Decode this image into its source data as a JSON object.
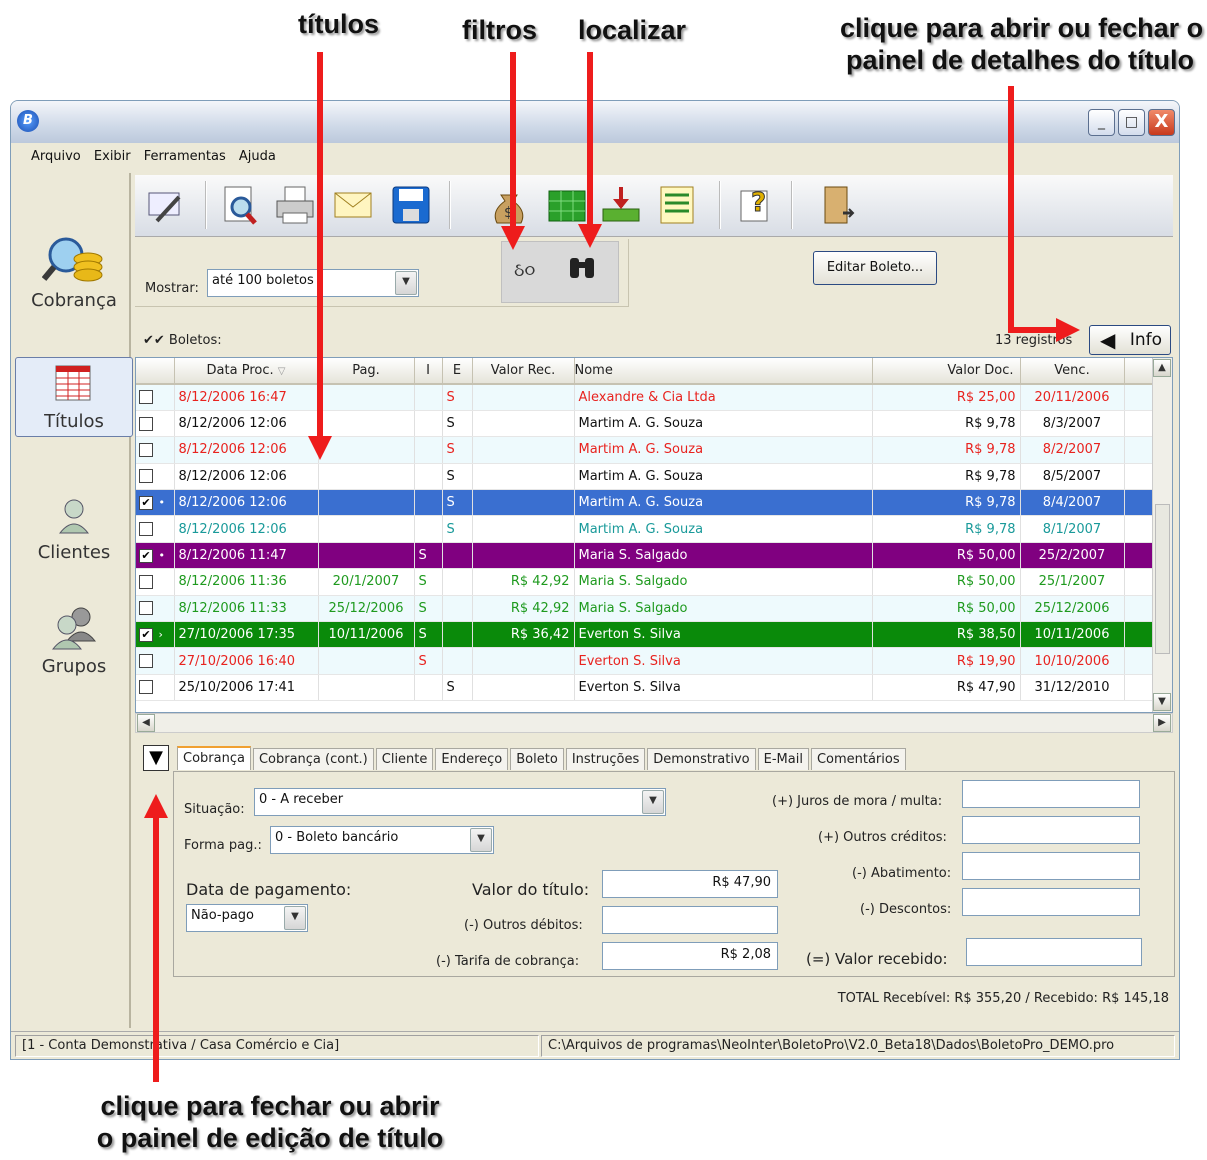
{
  "annotations": {
    "titulos": "títulos",
    "filtros": "filtros",
    "localizar": "localizar",
    "info_line1": "clique para abrir ou fechar o",
    "info_line2": "painel de detalhes do título",
    "edit_line1": "clique para fechar ou abrir",
    "edit_line2": "o painel de edição de título"
  },
  "window": {
    "minimize": "_",
    "maximize": "□",
    "close": "X",
    "logo": "B"
  },
  "menu": [
    "Arquivo",
    "Exibir",
    "Ferramentas",
    "Ajuda"
  ],
  "nav": {
    "cobranca": "Cobrança",
    "titulos": "Títulos",
    "clientes": "Clientes",
    "grupos": "Grupos"
  },
  "toolbar": [
    "edit-icon",
    "preview-icon",
    "print-icon",
    "mail-icon",
    "save-icon",
    "money-bag-icon",
    "spreadsheet-icon",
    "import-icon",
    "list-icon",
    "help-icon",
    "exit-icon"
  ],
  "filter": {
    "mostrar_label": "Mostrar:",
    "mostrar_value": "até 100 boletos",
    "filtros_icon": "glasses-icon",
    "localizar_icon": "binoculars-icon",
    "edit_button": "Editar Boleto...",
    "boletos_label": "✔✔ Boletos:",
    "registros": "13 registros",
    "info_button": "Info"
  },
  "grid": {
    "columns": [
      "",
      "Data Proc.",
      "Pag.",
      "I",
      "E",
      "Valor Rec.",
      "Nome",
      "Valor Doc.",
      "Venc."
    ],
    "rows": [
      {
        "sel": "",
        "data": "8/12/2006 16:47",
        "pag": "",
        "i": "",
        "e": "S",
        "valor_rec": "",
        "nome": "Alexandre & Cia Ltda",
        "valor_doc": "R$ 25,00",
        "venc": "20/11/2006",
        "color": "#e8231f",
        "bg": "#eefafd"
      },
      {
        "sel": "",
        "data": "8/12/2006 12:06",
        "pag": "",
        "i": "",
        "e": "S",
        "valor_rec": "",
        "nome": "Martim A. G. Souza",
        "valor_doc": "R$ 9,78",
        "venc": "8/3/2007",
        "color": "#111111",
        "bg": "#ffffff"
      },
      {
        "sel": "",
        "data": "8/12/2006 12:06",
        "pag": "",
        "i": "",
        "e": "S",
        "valor_rec": "",
        "nome": "Martim A. G. Souza",
        "valor_doc": "R$ 9,78",
        "venc": "8/2/2007",
        "color": "#e8231f",
        "bg": "#eefafd"
      },
      {
        "sel": "",
        "data": "8/12/2006 12:06",
        "pag": "",
        "i": "",
        "e": "S",
        "valor_rec": "",
        "nome": "Martim A. G. Souza",
        "valor_doc": "R$ 9,78",
        "venc": "8/5/2007",
        "color": "#111111",
        "bg": "#ffffff"
      },
      {
        "sel": "✔ •",
        "data": "8/12/2006 12:06",
        "pag": "",
        "i": "",
        "e": "S",
        "valor_rec": "",
        "nome": "Martim A. G. Souza",
        "valor_doc": "R$ 9,78",
        "venc": "8/4/2007",
        "color": "#ffffff",
        "bg": "#3a6fd0"
      },
      {
        "sel": "",
        "data": "8/12/2006 12:06",
        "pag": "",
        "i": "",
        "e": "S",
        "valor_rec": "",
        "nome": "Martim A. G. Souza",
        "valor_doc": "R$ 9,78",
        "venc": "8/1/2007",
        "color": "#1a9a9a",
        "bg": "#ffffff"
      },
      {
        "sel": "✔ •",
        "data": "8/12/2006 11:47",
        "pag": "",
        "i": "S",
        "e": "",
        "valor_rec": "",
        "nome": "Maria S. Salgado",
        "valor_doc": "R$ 50,00",
        "venc": "25/2/2007",
        "color": "#ffffff",
        "bg": "#800080"
      },
      {
        "sel": "",
        "data": "8/12/2006 11:36",
        "pag": "20/1/2007",
        "i": "S",
        "e": "",
        "valor_rec": "R$ 42,92",
        "nome": "Maria S. Salgado",
        "valor_doc": "R$ 50,00",
        "venc": "25/1/2007",
        "color": "#1f9a1f",
        "bg": "#ffffff"
      },
      {
        "sel": "",
        "data": "8/12/2006 11:33",
        "pag": "25/12/2006",
        "i": "S",
        "e": "",
        "valor_rec": "R$ 42,92",
        "nome": "Maria S. Salgado",
        "valor_doc": "R$ 50,00",
        "venc": "25/12/2006",
        "color": "#1f9a1f",
        "bg": "#eefafd"
      },
      {
        "sel": "✔ ›",
        "data": "27/10/2006 17:35",
        "pag": "10/11/2006",
        "i": "S",
        "e": "",
        "valor_rec": "R$ 36,42",
        "nome": "Everton S. Silva",
        "valor_doc": "R$ 38,50",
        "venc": "10/11/2006",
        "color": "#ffffff",
        "bg": "#0a8a0a"
      },
      {
        "sel": "",
        "data": "27/10/2006 16:40",
        "pag": "",
        "i": "S",
        "e": "",
        "valor_rec": "",
        "nome": "Everton S. Silva",
        "valor_doc": "R$ 19,90",
        "venc": "10/10/2006",
        "color": "#e8231f",
        "bg": "#eefafd"
      },
      {
        "sel": "",
        "data": "25/10/2006 17:41",
        "pag": "",
        "i": "",
        "e": "S",
        "valor_rec": "",
        "nome": "Everton S. Silva",
        "valor_doc": "R$ 47,90",
        "venc": "31/12/2010",
        "color": "#111111",
        "bg": "#ffffff"
      }
    ]
  },
  "editor": {
    "tabs": [
      "Cobrança",
      "Cobrança (cont.)",
      "Cliente",
      "Endereço",
      "Boleto",
      "Instruções",
      "Demonstrativo",
      "E-Mail",
      "Comentários"
    ],
    "situacao_label": "Situação:",
    "situacao_value": "0 - A receber",
    "forma_label": "Forma pag.:",
    "forma_value": "0 - Boleto bancário",
    "data_pag_label": "Data de pagamento:",
    "data_pag_value": "Não-pago",
    "valor_titulo_label": "Valor do título:",
    "valor_titulo": "R$ 47,90",
    "outros_debitos_label": "(-) Outros débitos:",
    "outros_debitos": "",
    "tarifa_label": "(-) Tarifa de cobrança:",
    "tarifa": "R$ 2,08",
    "juros_label": "(+) Juros de mora / multa:",
    "outros_creditos_label": "(+) Outros créditos:",
    "abatimento_label": "(-) Abatimento:",
    "descontos_label": "(-) Descontos:",
    "valor_recebido_label": "(=) Valor recebido:",
    "total": "TOTAL Recebível: R$ 355,20 / Recebido: R$ 145,18"
  },
  "status": {
    "left": "[1 - Conta Demonstrativa / Casa Comércio e Cia]",
    "right": "C:\\Arquivos de programas\\NeoInter\\BoletoPro\\V2.0_Beta18\\Dados\\BoletoPro_DEMO.pro"
  }
}
